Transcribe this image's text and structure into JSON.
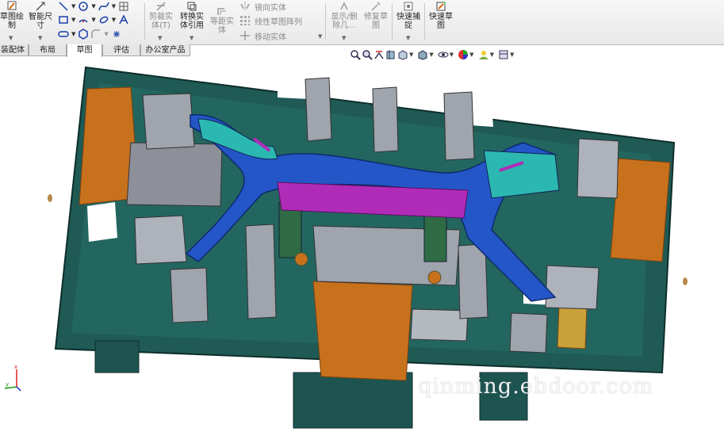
{
  "ribbon": {
    "sketch_draw": "草图绘\n制",
    "smart_dim": "智能尺\n寸",
    "trim": "剪裁实\n体(T)",
    "convert": "转换实\n体引用",
    "offset": "等距实\n体",
    "mirror": "镜向实体",
    "linear_pattern": "线性草图阵列",
    "move": "移动实体",
    "display_delete": "显示/删\n除几...",
    "repair": "修复草\n图",
    "quick_snap": "快速捕\n捉",
    "rapid_sketch": "快速草\n图"
  },
  "tabs": [
    {
      "label": "装配体"
    },
    {
      "label": "布局"
    },
    {
      "label": "草图"
    },
    {
      "label": "评估"
    },
    {
      "label": "办公室产品"
    }
  ],
  "active_tab": "草图",
  "watermark": "qinming.ebdoor.com",
  "triad": {
    "x_label": "x",
    "y_label": "y"
  },
  "colors": {
    "fixture_base": "#1f5a55",
    "part_blue": "#2456c8",
    "part_cyan": "#2bb8b0",
    "part_magenta": "#b02cb8",
    "orange_block": "#c8711d",
    "gray_clamp": "#9fa4ad"
  }
}
